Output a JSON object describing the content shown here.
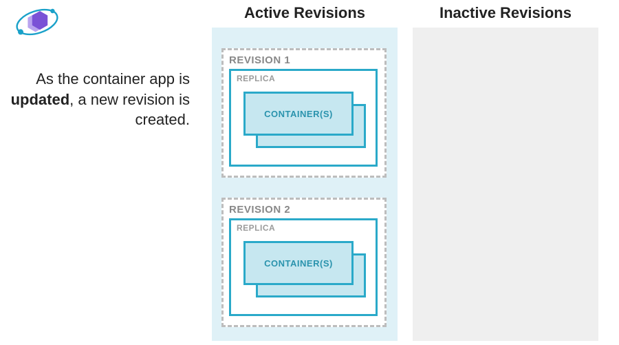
{
  "description": {
    "pre": "As the container app is ",
    "bold": "updated",
    "post": ", a new revision is created."
  },
  "columns": {
    "active": {
      "title": "Active Revisions"
    },
    "inactive": {
      "title": "Inactive Revisions"
    }
  },
  "revisions": {
    "0": {
      "label": "REVISION 1",
      "replica_label": "REPLICA",
      "container_label": "CONTAINER(S)"
    },
    "1": {
      "label": "REVISION 2",
      "replica_label": "REPLICA",
      "container_label": "CONTAINER(S)"
    }
  },
  "colors": {
    "active_bg": "#dff1f7",
    "inactive_bg": "#efefef",
    "dash_border": "#bdbdbd",
    "accent": "#2aa9c9",
    "accent_fill": "#c6e7f0",
    "logo_purple": "#7a52d6",
    "logo_blue": "#1aa1c9"
  }
}
